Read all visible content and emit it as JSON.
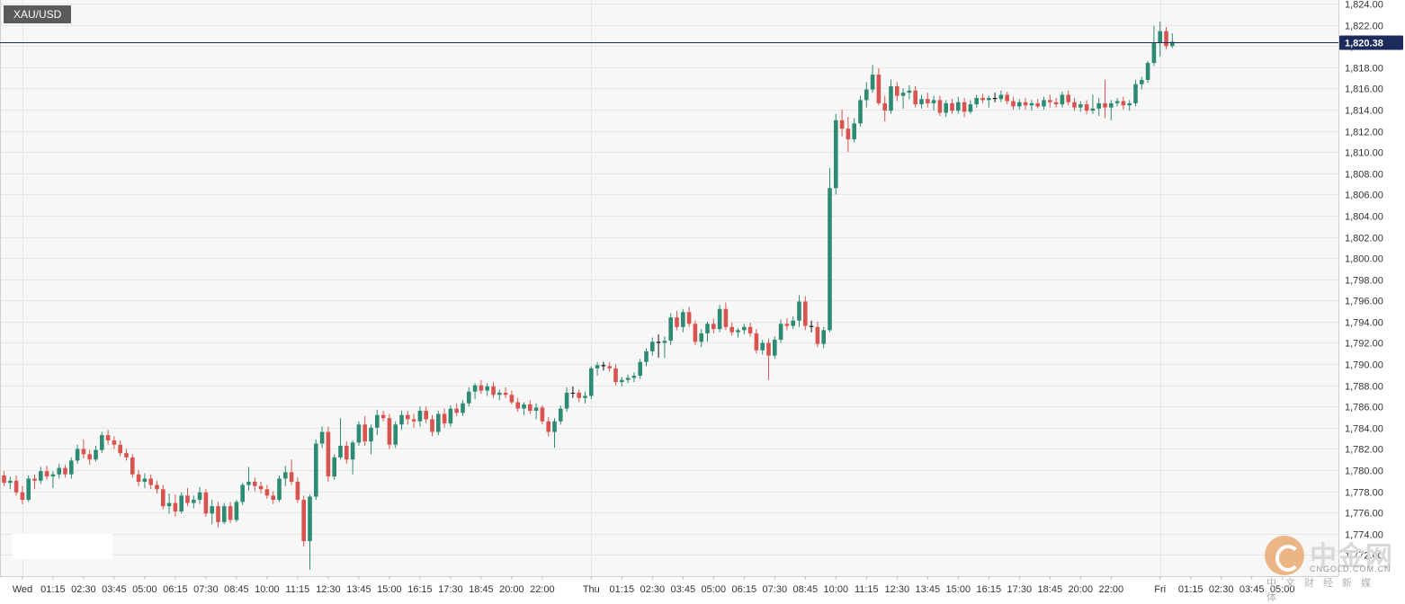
{
  "symbol": "XAU/USD",
  "colors": {
    "up": "#2e8b73",
    "down": "#d9534f",
    "grid": "#e6e6e6",
    "price_line": "#1a2b5c",
    "price_label_bg": "#1a2b5c",
    "axis_text": "#333333"
  },
  "current_price_label": "1,820.38",
  "watermark": {
    "cn_name": "中金网",
    "url": "CNGOLD.COM.CN",
    "tagline": "中文财经新媒体"
  },
  "chart_data": {
    "type": "candlestick",
    "title": "",
    "xlabel": "",
    "ylabel": "",
    "ylim": [
      1770,
      1824
    ],
    "grid": true,
    "current_price": 1820.38,
    "y_ticks": [
      "1,772.00",
      "1,774.00",
      "1,776.00",
      "1,778.00",
      "1,780.00",
      "1,782.00",
      "1,784.00",
      "1,786.00",
      "1,788.00",
      "1,790.00",
      "1,792.00",
      "1,794.00",
      "1,796.00",
      "1,798.00",
      "1,800.00",
      "1,802.00",
      "1,804.00",
      "1,806.00",
      "1,808.00",
      "1,810.00",
      "1,812.00",
      "1,814.00",
      "1,816.00",
      "1,818.00",
      "1,820.00",
      "1,822.00",
      "1,824.00"
    ],
    "y_tick_values": [
      1772,
      1774,
      1776,
      1778,
      1780,
      1782,
      1784,
      1786,
      1788,
      1790,
      1792,
      1794,
      1796,
      1798,
      1800,
      1802,
      1804,
      1806,
      1808,
      1810,
      1812,
      1814,
      1816,
      1818,
      1820,
      1822,
      1824
    ],
    "x_ticks": [
      {
        "label": "Wed",
        "index": 3
      },
      {
        "label": "01:15",
        "index": 8
      },
      {
        "label": "02:30",
        "index": 13
      },
      {
        "label": "03:45",
        "index": 18
      },
      {
        "label": "05:00",
        "index": 23
      },
      {
        "label": "06:15",
        "index": 28
      },
      {
        "label": "07:30",
        "index": 33
      },
      {
        "label": "08:45",
        "index": 38
      },
      {
        "label": "10:00",
        "index": 43
      },
      {
        "label": "11:15",
        "index": 48
      },
      {
        "label": "12:30",
        "index": 53
      },
      {
        "label": "13:45",
        "index": 58
      },
      {
        "label": "15:00",
        "index": 63
      },
      {
        "label": "16:15",
        "index": 68
      },
      {
        "label": "17:30",
        "index": 73
      },
      {
        "label": "18:45",
        "index": 78
      },
      {
        "label": "20:00",
        "index": 83
      },
      {
        "label": "22:00",
        "index": 88
      },
      {
        "label": "Thu",
        "index": 96
      },
      {
        "label": "01:15",
        "index": 101
      },
      {
        "label": "02:30",
        "index": 106
      },
      {
        "label": "03:45",
        "index": 111
      },
      {
        "label": "05:00",
        "index": 116
      },
      {
        "label": "06:15",
        "index": 121
      },
      {
        "label": "07:30",
        "index": 126
      },
      {
        "label": "08:45",
        "index": 131
      },
      {
        "label": "10:00",
        "index": 136
      },
      {
        "label": "11:15",
        "index": 141
      },
      {
        "label": "12:30",
        "index": 146
      },
      {
        "label": "13:45",
        "index": 151
      },
      {
        "label": "15:00",
        "index": 156
      },
      {
        "label": "16:15",
        "index": 161
      },
      {
        "label": "17:30",
        "index": 166
      },
      {
        "label": "18:45",
        "index": 171
      },
      {
        "label": "20:00",
        "index": 176
      },
      {
        "label": "22:00",
        "index": 181
      },
      {
        "label": "Fri",
        "index": 189
      },
      {
        "label": "01:15",
        "index": 194
      },
      {
        "label": "02:30",
        "index": 199
      },
      {
        "label": "03:45",
        "index": 204
      },
      {
        "label": "05:00",
        "index": 209
      }
    ],
    "candles": [
      [
        1779.5,
        1779.9,
        1778.5,
        1778.8
      ],
      [
        1778.8,
        1779.4,
        1778.2,
        1779.0
      ],
      [
        1779.0,
        1779.5,
        1777.6,
        1777.9
      ],
      [
        1777.9,
        1778.5,
        1776.8,
        1777.2
      ],
      [
        1777.2,
        1779.5,
        1777.0,
        1779.2
      ],
      [
        1779.2,
        1779.6,
        1778.2,
        1779.0
      ],
      [
        1779.0,
        1780.3,
        1778.7,
        1779.9
      ],
      [
        1779.9,
        1780.4,
        1779.1,
        1779.4
      ],
      [
        1779.4,
        1779.9,
        1778.3,
        1779.6
      ],
      [
        1779.6,
        1780.6,
        1779.2,
        1780.2
      ],
      [
        1780.2,
        1780.5,
        1779.3,
        1779.6
      ],
      [
        1779.6,
        1781.2,
        1779.2,
        1780.9
      ],
      [
        1780.9,
        1782.4,
        1780.6,
        1782.0
      ],
      [
        1782.0,
        1782.9,
        1781.1,
        1781.5
      ],
      [
        1781.5,
        1781.9,
        1780.5,
        1781.0
      ],
      [
        1781.0,
        1782.3,
        1780.8,
        1781.9
      ],
      [
        1781.9,
        1783.6,
        1781.6,
        1783.3
      ],
      [
        1783.3,
        1783.8,
        1782.4,
        1782.8
      ],
      [
        1782.8,
        1783.2,
        1782.0,
        1782.4
      ],
      [
        1782.4,
        1782.8,
        1781.3,
        1781.6
      ],
      [
        1781.6,
        1782.0,
        1780.9,
        1781.2
      ],
      [
        1781.2,
        1781.5,
        1779.3,
        1779.6
      ],
      [
        1779.6,
        1780.0,
        1778.5,
        1778.9
      ],
      [
        1778.9,
        1779.7,
        1778.3,
        1779.2
      ],
      [
        1779.2,
        1779.6,
        1778.2,
        1778.6
      ],
      [
        1778.6,
        1779.0,
        1777.8,
        1778.2
      ],
      [
        1778.2,
        1778.6,
        1776.3,
        1776.6
      ],
      [
        1776.6,
        1777.8,
        1775.9,
        1776.9
      ],
      [
        1776.9,
        1777.7,
        1775.6,
        1776.1
      ],
      [
        1776.1,
        1777.9,
        1775.9,
        1777.6
      ],
      [
        1777.6,
        1778.3,
        1776.6,
        1776.9
      ],
      [
        1776.9,
        1777.6,
        1776.4,
        1777.2
      ],
      [
        1777.2,
        1778.4,
        1776.8,
        1777.9
      ],
      [
        1777.9,
        1778.2,
        1775.6,
        1775.9
      ],
      [
        1775.9,
        1777.2,
        1774.9,
        1776.6
      ],
      [
        1776.6,
        1777.0,
        1774.6,
        1775.1
      ],
      [
        1775.1,
        1776.9,
        1774.9,
        1776.6
      ],
      [
        1776.6,
        1777.0,
        1775.0,
        1775.3
      ],
      [
        1775.3,
        1777.2,
        1775.1,
        1777.0
      ],
      [
        1777.0,
        1778.8,
        1776.7,
        1778.6
      ],
      [
        1778.6,
        1780.3,
        1778.1,
        1778.9
      ],
      [
        1778.9,
        1779.3,
        1778.0,
        1778.5
      ],
      [
        1778.5,
        1778.9,
        1777.8,
        1778.2
      ],
      [
        1778.2,
        1778.6,
        1777.3,
        1777.6
      ],
      [
        1777.6,
        1778.0,
        1776.8,
        1777.2
      ],
      [
        1777.2,
        1779.5,
        1777.0,
        1779.2
      ],
      [
        1779.2,
        1780.4,
        1778.5,
        1779.8
      ],
      [
        1779.8,
        1781.0,
        1778.6,
        1778.9
      ],
      [
        1778.9,
        1779.3,
        1776.9,
        1777.2
      ],
      [
        1777.2,
        1777.6,
        1772.8,
        1773.3
      ],
      [
        1773.3,
        1777.7,
        1770.6,
        1777.5
      ],
      [
        1777.5,
        1782.9,
        1777.2,
        1782.5
      ],
      [
        1782.5,
        1784.1,
        1782.1,
        1783.6
      ],
      [
        1783.6,
        1784.1,
        1778.9,
        1779.4
      ],
      [
        1779.4,
        1781.5,
        1779.1,
        1781.2
      ],
      [
        1781.2,
        1784.9,
        1781.0,
        1782.3
      ],
      [
        1782.3,
        1782.7,
        1780.6,
        1781.0
      ],
      [
        1781.0,
        1782.8,
        1779.6,
        1782.6
      ],
      [
        1782.6,
        1784.6,
        1782.3,
        1784.3
      ],
      [
        1784.3,
        1785.1,
        1782.3,
        1782.7
      ],
      [
        1782.7,
        1784.3,
        1781.5,
        1784.0
      ],
      [
        1784.0,
        1785.7,
        1783.3,
        1785.2
      ],
      [
        1785.2,
        1785.6,
        1784.6,
        1784.9
      ],
      [
        1784.9,
        1785.3,
        1782.0,
        1782.4
      ],
      [
        1782.4,
        1784.6,
        1782.1,
        1784.3
      ],
      [
        1784.3,
        1785.6,
        1783.8,
        1785.2
      ],
      [
        1785.2,
        1785.6,
        1784.3,
        1784.8
      ],
      [
        1784.8,
        1785.3,
        1784.0,
        1784.6
      ],
      [
        1784.6,
        1786.0,
        1784.1,
        1785.6
      ],
      [
        1785.6,
        1786.0,
        1784.4,
        1784.8
      ],
      [
        1784.8,
        1785.2,
        1783.2,
        1783.6
      ],
      [
        1783.6,
        1785.6,
        1783.3,
        1785.3
      ],
      [
        1785.3,
        1785.8,
        1784.0,
        1784.4
      ],
      [
        1784.4,
        1786.1,
        1784.1,
        1785.8
      ],
      [
        1785.8,
        1786.3,
        1785.1,
        1785.4
      ],
      [
        1785.4,
        1786.6,
        1785.1,
        1786.3
      ],
      [
        1786.3,
        1787.8,
        1786.0,
        1787.4
      ],
      [
        1787.4,
        1788.2,
        1786.7,
        1788.0
      ],
      [
        1788.0,
        1788.5,
        1787.2,
        1787.5
      ],
      [
        1787.5,
        1788.2,
        1787.0,
        1787.9
      ],
      [
        1787.9,
        1788.3,
        1786.8,
        1787.1
      ],
      [
        1787.1,
        1787.6,
        1786.6,
        1787.3
      ],
      [
        1787.3,
        1787.8,
        1786.8,
        1787.1
      ],
      [
        1787.1,
        1787.5,
        1786.2,
        1786.4
      ],
      [
        1786.4,
        1786.8,
        1785.5,
        1785.8
      ],
      [
        1785.8,
        1786.4,
        1785.2,
        1786.2
      ],
      [
        1786.2,
        1786.6,
        1785.3,
        1785.6
      ],
      [
        1785.6,
        1786.3,
        1784.8,
        1785.9
      ],
      [
        1785.9,
        1786.1,
        1784.3,
        1784.6
      ],
      [
        1784.6,
        1785.0,
        1783.2,
        1783.6
      ],
      [
        1783.6,
        1784.9,
        1782.1,
        1784.6
      ],
      [
        1784.6,
        1786.1,
        1784.3,
        1785.8
      ],
      [
        1785.8,
        1787.8,
        1785.5,
        1787.3
      ],
      [
        1787.3,
        1787.9,
        1786.8,
        1787.3
      ],
      [
        1787.3,
        1787.6,
        1786.4,
        1786.8
      ],
      [
        1786.8,
        1787.4,
        1786.3,
        1787.0
      ],
      [
        1787.0,
        1789.8,
        1786.7,
        1789.6
      ],
      [
        1789.6,
        1790.2,
        1788.9,
        1789.9
      ],
      [
        1789.9,
        1790.2,
        1789.4,
        1789.8
      ],
      [
        1789.8,
        1790.2,
        1789.3,
        1789.6
      ],
      [
        1789.6,
        1790.0,
        1788.0,
        1788.3
      ],
      [
        1788.3,
        1788.8,
        1787.9,
        1788.5
      ],
      [
        1788.5,
        1789.0,
        1788.2,
        1788.7
      ],
      [
        1788.7,
        1789.2,
        1788.3,
        1788.9
      ],
      [
        1788.9,
        1790.5,
        1788.6,
        1790.2
      ],
      [
        1790.2,
        1791.5,
        1789.8,
        1791.2
      ],
      [
        1791.2,
        1792.5,
        1790.8,
        1792.1
      ],
      [
        1792.1,
        1792.8,
        1790.6,
        1792.0
      ],
      [
        1792.0,
        1792.6,
        1790.6,
        1792.2
      ],
      [
        1792.2,
        1794.8,
        1791.8,
        1794.4
      ],
      [
        1794.4,
        1795.0,
        1793.2,
        1793.5
      ],
      [
        1793.5,
        1795.2,
        1793.0,
        1794.9
      ],
      [
        1794.9,
        1795.4,
        1793.5,
        1793.8
      ],
      [
        1793.8,
        1794.1,
        1791.8,
        1792.1
      ],
      [
        1792.1,
        1793.3,
        1791.6,
        1792.9
      ],
      [
        1792.9,
        1794.0,
        1792.1,
        1793.8
      ],
      [
        1793.8,
        1794.3,
        1792.9,
        1793.3
      ],
      [
        1793.3,
        1795.6,
        1793.0,
        1795.2
      ],
      [
        1795.2,
        1795.8,
        1793.2,
        1793.5
      ],
      [
        1793.5,
        1793.9,
        1792.7,
        1793.0
      ],
      [
        1793.0,
        1793.4,
        1792.5,
        1793.2
      ],
      [
        1793.2,
        1793.8,
        1792.8,
        1793.5
      ],
      [
        1793.5,
        1793.9,
        1792.6,
        1792.9
      ],
      [
        1792.9,
        1793.3,
        1791.0,
        1791.3
      ],
      [
        1791.3,
        1792.3,
        1790.9,
        1792.0
      ],
      [
        1792.0,
        1792.4,
        1788.5,
        1790.8
      ],
      [
        1790.8,
        1792.6,
        1790.5,
        1792.3
      ],
      [
        1792.3,
        1794.2,
        1792.0,
        1793.8
      ],
      [
        1793.8,
        1794.3,
        1793.2,
        1793.6
      ],
      [
        1793.6,
        1794.5,
        1793.3,
        1794.1
      ],
      [
        1794.1,
        1796.5,
        1793.5,
        1795.9
      ],
      [
        1795.9,
        1796.4,
        1793.2,
        1793.6
      ],
      [
        1793.6,
        1794.1,
        1793.0,
        1793.5
      ],
      [
        1793.5,
        1794.0,
        1791.6,
        1791.9
      ],
      [
        1791.9,
        1793.5,
        1791.5,
        1793.2
      ],
      [
        1793.2,
        1808.5,
        1793.0,
        1806.6
      ],
      [
        1806.6,
        1813.6,
        1806.0,
        1813.0
      ],
      [
        1813.0,
        1814.0,
        1811.5,
        1812.2
      ],
      [
        1812.2,
        1813.3,
        1810.0,
        1811.2
      ],
      [
        1811.2,
        1813.2,
        1810.9,
        1812.7
      ],
      [
        1812.7,
        1815.3,
        1812.4,
        1814.9
      ],
      [
        1814.9,
        1816.6,
        1814.2,
        1815.9
      ],
      [
        1815.9,
        1818.2,
        1815.6,
        1817.3
      ],
      [
        1817.3,
        1817.9,
        1814.4,
        1814.6
      ],
      [
        1814.6,
        1815.3,
        1812.9,
        1813.9
      ],
      [
        1813.9,
        1816.8,
        1813.6,
        1816.2
      ],
      [
        1816.2,
        1816.6,
        1814.8,
        1815.3
      ],
      [
        1815.3,
        1816.0,
        1814.1,
        1815.6
      ],
      [
        1815.6,
        1816.3,
        1815.0,
        1815.8
      ],
      [
        1815.8,
        1816.2,
        1814.2,
        1814.5
      ],
      [
        1814.5,
        1815.4,
        1814.1,
        1815.0
      ],
      [
        1815.0,
        1815.6,
        1814.2,
        1814.6
      ],
      [
        1814.6,
        1815.3,
        1813.9,
        1814.9
      ],
      [
        1814.9,
        1815.3,
        1813.4,
        1813.7
      ],
      [
        1813.7,
        1814.9,
        1813.3,
        1814.6
      ],
      [
        1814.6,
        1815.0,
        1813.6,
        1813.9
      ],
      [
        1813.9,
        1815.2,
        1813.6,
        1814.7
      ],
      [
        1814.7,
        1815.1,
        1813.3,
        1813.8
      ],
      [
        1813.8,
        1814.9,
        1813.6,
        1814.5
      ],
      [
        1814.5,
        1815.4,
        1814.2,
        1815.1
      ],
      [
        1815.1,
        1815.5,
        1814.6,
        1814.9
      ],
      [
        1814.9,
        1815.3,
        1814.2,
        1815.1
      ],
      [
        1815.1,
        1815.6,
        1814.7,
        1815.0
      ],
      [
        1815.0,
        1815.8,
        1814.7,
        1815.4
      ],
      [
        1815.4,
        1815.7,
        1814.5,
        1814.8
      ],
      [
        1814.8,
        1815.2,
        1814.0,
        1814.3
      ],
      [
        1814.3,
        1815.0,
        1814.0,
        1814.7
      ],
      [
        1814.7,
        1815.1,
        1814.0,
        1814.4
      ],
      [
        1814.4,
        1814.9,
        1813.9,
        1814.6
      ],
      [
        1814.6,
        1815.0,
        1814.1,
        1814.3
      ],
      [
        1814.3,
        1815.2,
        1814.0,
        1814.9
      ],
      [
        1814.9,
        1815.4,
        1814.2,
        1814.7
      ],
      [
        1814.7,
        1815.1,
        1814.2,
        1814.5
      ],
      [
        1814.5,
        1815.7,
        1814.2,
        1815.4
      ],
      [
        1815.4,
        1815.8,
        1814.4,
        1814.7
      ],
      [
        1814.7,
        1815.1,
        1813.9,
        1814.2
      ],
      [
        1814.2,
        1814.8,
        1813.8,
        1814.5
      ],
      [
        1814.5,
        1814.9,
        1813.6,
        1813.9
      ],
      [
        1813.9,
        1815.4,
        1813.6,
        1814.1
      ],
      [
        1814.1,
        1815.1,
        1813.4,
        1814.6
      ],
      [
        1814.6,
        1816.8,
        1813.2,
        1814.2
      ],
      [
        1814.2,
        1814.9,
        1813.0,
        1814.6
      ],
      [
        1814.6,
        1815.1,
        1814.3,
        1814.8
      ],
      [
        1814.8,
        1815.2,
        1814.0,
        1814.4
      ],
      [
        1814.4,
        1814.9,
        1813.9,
        1814.6
      ],
      [
        1814.6,
        1816.8,
        1814.3,
        1816.4
      ],
      [
        1816.4,
        1817.1,
        1815.9,
        1816.8
      ],
      [
        1816.8,
        1818.6,
        1816.5,
        1818.4
      ],
      [
        1818.4,
        1821.9,
        1818.1,
        1820.3
      ],
      [
        1820.3,
        1822.3,
        1819.0,
        1821.4
      ],
      [
        1821.4,
        1821.8,
        1819.7,
        1820.0
      ],
      [
        1820.0,
        1821.2,
        1819.8,
        1820.4
      ]
    ]
  }
}
